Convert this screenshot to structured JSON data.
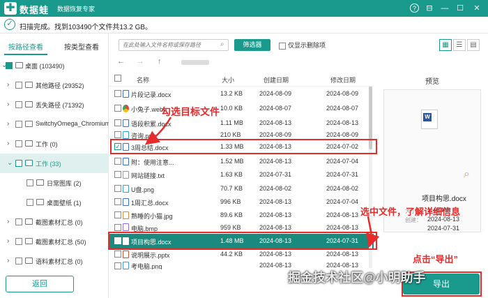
{
  "app": {
    "name": "数据蛙",
    "subtitle": "数据恢复专家"
  },
  "status": {
    "text": "扫描完成。找到103490个文件共13.2 GB。"
  },
  "left_tabs": [
    {
      "label": "按路径查看",
      "active": true
    },
    {
      "label": "按类型查看",
      "active": false
    }
  ],
  "tree": [
    {
      "label": "桌面 (103490)"
    },
    {
      "label": "其他路径 (29352)"
    },
    {
      "label": "丢失路径 (71392)"
    },
    {
      "label": "SwitchyOmega_Chromium"
    },
    {
      "label": "工作 (0)"
    },
    {
      "label": "工作 (33)"
    },
    {
      "label": "日常图库 (2)"
    },
    {
      "label": "桌面壁纸 (1)"
    },
    {
      "label": "截图素材汇总 (0)"
    },
    {
      "label": "截图素材汇总 (50)"
    },
    {
      "label": "语料素材汇总 (0)"
    }
  ],
  "back_button": "返回",
  "toolbar": {
    "path_placeholder": "在此处输入文件名称或保存路径",
    "filter_label": "筛选器",
    "only_deleted": "仅显示删除项"
  },
  "table": {
    "headers": {
      "name": "名称",
      "size": "大小",
      "created": "创建日期",
      "modified": "修改日期"
    },
    "rows": [
      {
        "name": "片段记录.docx",
        "size": "13.2 KB",
        "created": "2024-08-09",
        "modified": "2024-08-09",
        "icon": "docx"
      },
      {
        "name": "小兔子.webp",
        "size": "10.0 KB",
        "created": "2024-08-07",
        "modified": "2024-08-07",
        "icon": "webp"
      },
      {
        "name": "语段积累.docx",
        "size": "1.11 MB",
        "created": "2024-08-13",
        "modified": "2024-08-13",
        "icon": "docx"
      },
      {
        "name": "咨询.png",
        "size": "210 KB",
        "created": "2024-08-09",
        "modified": "2024-08-09",
        "icon": "png"
      },
      {
        "name": "3周总结.docx",
        "size": "1.33 MB",
        "created": "2024-08-13",
        "modified": "2024-07-02",
        "icon": "docx",
        "checked": true
      },
      {
        "name": "附：使用注意...",
        "size": "1.52 MB",
        "created": "2024-08-13",
        "modified": "2024-07-04",
        "icon": "docx"
      },
      {
        "name": "网站链接.txt",
        "size": "1.63 KB",
        "created": "2024-07-31",
        "modified": "2024-07-31",
        "icon": "txt"
      },
      {
        "name": "U盘.png",
        "size": "70.7 KB",
        "created": "2024-08-02",
        "modified": "2024-08-02",
        "icon": "png"
      },
      {
        "name": "1周汇总.docx",
        "size": "996 KB",
        "created": "2024-08-13",
        "modified": "2024-07-04",
        "icon": "docx"
      },
      {
        "name": "熟睡的小猫.jpg",
        "size": "89.6 KB",
        "created": "2024-08-13",
        "modified": "2024-08-13",
        "icon": "jpg"
      },
      {
        "name": "电脑.bmp",
        "size": "959 KB",
        "created": "2024-08-13",
        "modified": "2024-08-13",
        "icon": "bmp"
      },
      {
        "name": "项目构思.docx",
        "size": "1.48 MB",
        "created": "2024-08-13",
        "modified": "2024-07-31",
        "icon": "docx",
        "selected": true
      },
      {
        "name": "说明展示.pptx",
        "size": "44.2 KB",
        "created": "2024-08-13",
        "modified": "2024-08-13",
        "icon": "pptx"
      },
      {
        "name": "考电脑.png",
        "size": "",
        "created": "2024-08-13",
        "modified": "2024-08-13",
        "icon": "png"
      }
    ]
  },
  "preview": {
    "title": "预览",
    "file_name": "项目构思.docx",
    "size_label": "大小：",
    "size": "1.48 MB",
    "created_label": "创建：",
    "created": "2024-08-13",
    "modified": "2024-07-31"
  },
  "export_button": "导出",
  "annotations": {
    "check_target": "勾选目标文件",
    "select_info": "选中文件，了解详细信息",
    "click_export": "点击“导出”"
  },
  "watermark": "掘金技术社区@小明助手",
  "colors": {
    "accent": "#1a9a8c",
    "annotation": "#e52b2b"
  }
}
